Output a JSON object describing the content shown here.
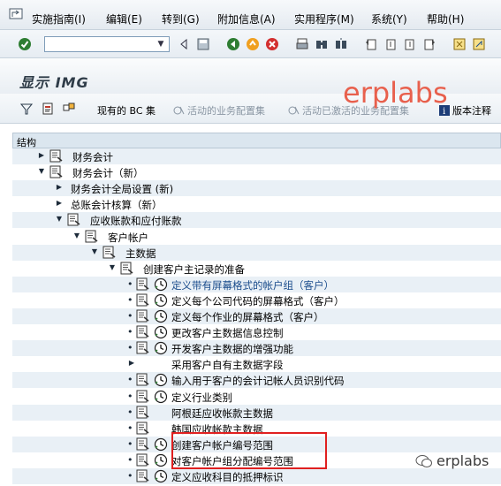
{
  "menu": [
    "实施指南(I)",
    "编辑(E)",
    "转到(G)",
    "附加信息(A)",
    "实用程序(M)",
    "系统(Y)",
    "帮助(H)"
  ],
  "page_title": "显示 IMG",
  "watermark": "erplabs",
  "app_toolbar": {
    "bc_sets": "现有的 BC 集",
    "active_bc_sets": "活动的业务配置集",
    "deactivated_bc_sets": "活动已激活的业务配置集",
    "release_notes": "版本注释"
  },
  "tree_header": "结构",
  "tree": [
    {
      "text": "财务会计",
      "level": 0,
      "expanded": false,
      "kind": "folder"
    },
    {
      "text": "财务会计（新）",
      "level": 0,
      "expanded": true,
      "kind": "folder"
    },
    {
      "text": "财务会计全局设置 (新)",
      "level": 1,
      "expanded": false,
      "kind": "plain"
    },
    {
      "text": "总账会计核算（新）",
      "level": 1,
      "expanded": false,
      "kind": "plain"
    },
    {
      "text": "应收账款和应付账款",
      "level": 1,
      "expanded": true,
      "kind": "folder"
    },
    {
      "text": "客户帐户",
      "level": 2,
      "expanded": true,
      "kind": "folder"
    },
    {
      "text": "主数据",
      "level": 3,
      "expanded": true,
      "kind": "folder"
    },
    {
      "text": "创建客户主记录的准备",
      "level": 4,
      "expanded": true,
      "kind": "folder"
    },
    {
      "text": "定义带有屏幕格式的帐户组（客户）",
      "level": 5,
      "kind": "activity",
      "link": true
    },
    {
      "text": "定义每个公司代码的屏幕格式（客户）",
      "level": 5,
      "kind": "activity"
    },
    {
      "text": "定义每个作业的屏幕格式（客户）",
      "level": 5,
      "kind": "activity"
    },
    {
      "text": "更改客户主数据信息控制",
      "level": 5,
      "kind": "activity"
    },
    {
      "text": "开发客户主数据的增强功能",
      "level": 5,
      "kind": "activity"
    },
    {
      "text": "采用客户自有主数据字段",
      "level": 5,
      "kind": "subnode"
    },
    {
      "text": "输入用于客户的会计记帐人员识别代码",
      "level": 5,
      "kind": "activity"
    },
    {
      "text": "定义行业类别",
      "level": 5,
      "kind": "activity"
    },
    {
      "text": "阿根廷应收帐款主数据",
      "level": 5,
      "kind": "doconly"
    },
    {
      "text": "韩国应收帐款主数据",
      "level": 5,
      "kind": "doconly"
    },
    {
      "text": "创建客户帐户编号范围",
      "level": 5,
      "kind": "activity"
    },
    {
      "text": "对客户帐户组分配编号范围",
      "level": 5,
      "kind": "activity"
    },
    {
      "text": "定义应收科目的抵押标识",
      "level": 5,
      "kind": "activity"
    }
  ],
  "wechat_tag": "erplabs"
}
